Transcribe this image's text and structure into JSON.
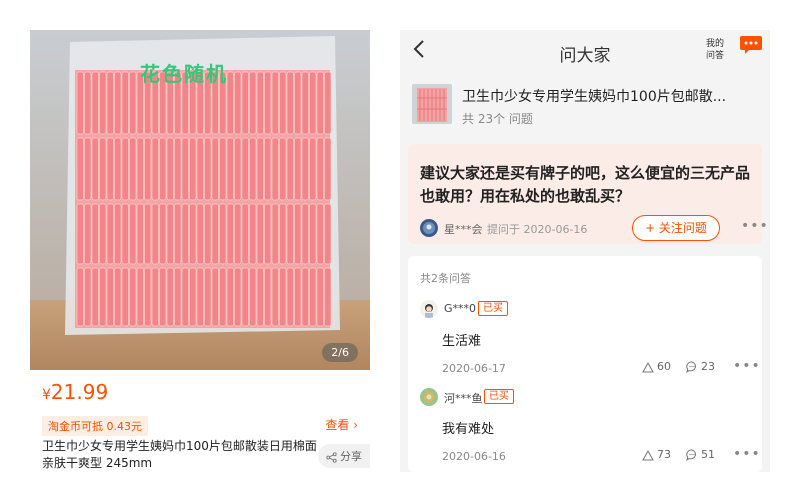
{
  "product": {
    "photo_tag": "花色随机",
    "page_indicator": "2/6",
    "price_symbol": "¥",
    "price": "21.99",
    "coupon": "淘金币可抵 0.43元",
    "view_label": "查看 ›",
    "title": "卫生巾少女专用学生姨妈巾100片包邮散装日用棉面亲肤干爽型 245mm",
    "share_label": "分享"
  },
  "qa": {
    "nav_title": "问大家",
    "back_icon": "chevron-left-icon",
    "mine_label_1": "我的",
    "mine_label_2": "问答",
    "more_icon": "more-dots-icon",
    "product_name": "卫生巾少女专用学生姨妈巾100片包邮散...",
    "question_count": "共 23个 问题",
    "question": "建议大家还是买有牌子的吧，这么便宜的三无产品也敢用？用在私处的也敢乱买？",
    "asker_name": "星***会",
    "asker_date": "提问于 2020-06-16",
    "follow_label": "+ 关注问题",
    "answer_count": "共2条问答",
    "bought_label": "已买",
    "answers": [
      {
        "name": "G***0",
        "text": "生活难",
        "date": "2020-06-17",
        "likes": "60",
        "comments": "23"
      },
      {
        "name": "河***鱼",
        "text": "我有难处",
        "date": "2020-06-16",
        "likes": "73",
        "comments": "51"
      }
    ]
  },
  "colors": {
    "accent": "#ff5000",
    "pad_pink": "#f2848a",
    "card_tint": "#fbece7"
  }
}
